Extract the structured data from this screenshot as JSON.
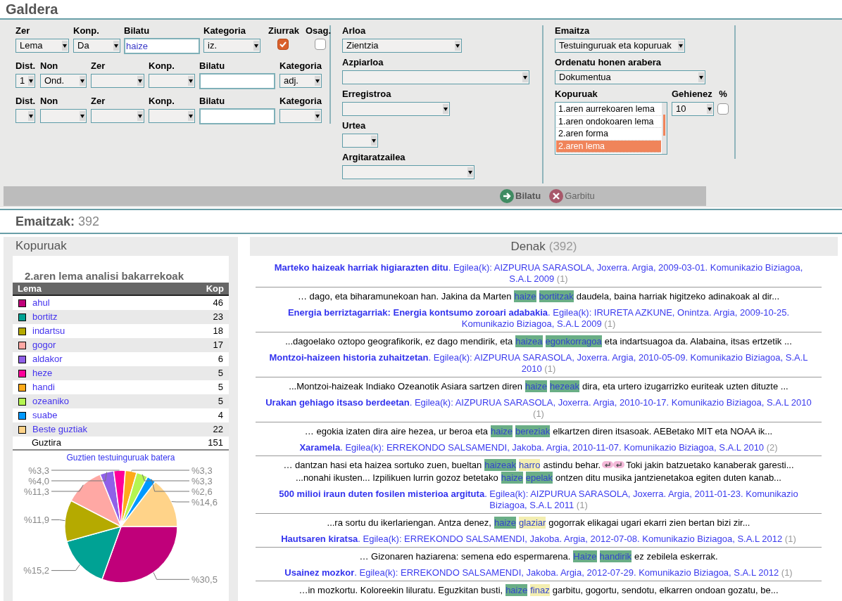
{
  "title": "Galdera",
  "query": {
    "rows": [
      {
        "fields": [
          {
            "label": "Zer",
            "kind": "select",
            "value": "Lema"
          },
          {
            "label": "Konp.",
            "kind": "select",
            "value": "Da"
          },
          {
            "label": "Bilatu",
            "kind": "text",
            "value": "haize"
          },
          {
            "label": "Kategoria",
            "kind": "select",
            "value": "iz."
          },
          {
            "label": "Ziurrak",
            "kind": "checkbox",
            "checked": true
          },
          {
            "label": "Osag.",
            "kind": "checkbox",
            "checked": false
          }
        ]
      },
      {
        "fields": [
          {
            "label": "Dist.",
            "kind": "select",
            "value": "1"
          },
          {
            "label": "Non",
            "kind": "select",
            "value": "Ond."
          },
          {
            "label": "Zer",
            "kind": "select"
          },
          {
            "label": "Konp.",
            "kind": "select"
          },
          {
            "label": "Bilatu",
            "kind": "text"
          },
          {
            "label": "Kategoria",
            "kind": "select",
            "value": "adj."
          }
        ]
      },
      {
        "fields": [
          {
            "label": "Dist.",
            "kind": "select"
          },
          {
            "label": "Non",
            "kind": "select"
          },
          {
            "label": "Zer",
            "kind": "select"
          },
          {
            "label": "Konp.",
            "kind": "select"
          },
          {
            "label": "Bilatu",
            "kind": "text"
          },
          {
            "label": "Kategoria",
            "kind": "select"
          }
        ]
      }
    ]
  },
  "filters": [
    {
      "label": "Arloa",
      "value": "Zientzia"
    },
    {
      "label": "Azpiarloa"
    },
    {
      "label": "Erregistroa"
    },
    {
      "label": "Urtea"
    },
    {
      "label": "Argitaratzailea"
    }
  ],
  "output": {
    "result_type": {
      "label": "Emaitza",
      "value": "Testuinguruak eta kopuruak"
    },
    "order": {
      "label": "Ordenatu honen arabera",
      "value": "Dokumentua"
    },
    "counts": {
      "label": "Kopuruak",
      "options": [
        {
          "text": "1.aren aurrekoaren lema",
          "selected": false
        },
        {
          "text": "1.aren ondokoaren lema",
          "selected": false
        },
        {
          "text": "2.aren forma",
          "selected": false
        },
        {
          "text": "2.aren lema",
          "selected": true
        }
      ]
    },
    "max": {
      "label": "Gehienez",
      "value": "10"
    },
    "percent": {
      "label": "%",
      "checked": false
    }
  },
  "actions": [
    {
      "label": "Bilatu",
      "kind": "search"
    },
    {
      "label": "Garbitu",
      "kind": "clear"
    }
  ],
  "results_heading": {
    "label": "Emaitzak:",
    "count": "392"
  },
  "counts_panel": {
    "title": "Kopuruak",
    "table_title": "2.aren lema analisi bakarrekoak",
    "columns": [
      "Lema",
      "Kop"
    ],
    "rows": [
      {
        "lemma": "ahul",
        "count": "46",
        "color": "#c0007a"
      },
      {
        "lemma": "bortitz",
        "count": "23",
        "color": "#00a294"
      },
      {
        "lemma": "indartsu",
        "count": "18",
        "color": "#b5aa00"
      },
      {
        "lemma": "gogor",
        "count": "17",
        "color": "#ffa8a4"
      },
      {
        "lemma": "aldakor",
        "count": "6",
        "color": "#9060e8"
      },
      {
        "lemma": "heze",
        "count": "5",
        "color": "#ff0099"
      },
      {
        "lemma": "handi",
        "count": "5",
        "color": "#ffaa1a"
      },
      {
        "lemma": "ozeaniko",
        "count": "5",
        "color": "#b5f551"
      },
      {
        "lemma": "suabe",
        "count": "4",
        "color": "#0099ff"
      },
      {
        "lemma": "Beste guztiak",
        "count": "22",
        "color": "#ffd389"
      }
    ],
    "total": {
      "label": "Guztira",
      "count": "151"
    },
    "chart_data": {
      "type": "pie",
      "title": "Guztien testuinguruak batera",
      "values": [
        30.5,
        15.2,
        11.9,
        11.3,
        4.0,
        3.3,
        3.3,
        3.3,
        2.6,
        14.6
      ],
      "value_labels": [
        "%30,5",
        "%15,2",
        "%11,9",
        "%11,3",
        "%4,0",
        "%3,3",
        "%3,3",
        "%3,3",
        "%2,6",
        "%14,6"
      ]
    }
  },
  "documents_panel": {
    "title": "Denak",
    "count": "(392)",
    "results": [
      {
        "title": "Marteko haizeak harriak higiarazten ditu",
        "source": ". Egilea(k): AIZPURUA SARASOLA, Joxerra. Argia, 2009-03-01. Komunikazio Biziagoa, S.A.L 2009",
        "count": "(1)",
        "contexts": [
          [
            {
              "kind": "text",
              "text": "… dago, eta biharamunekoan han. Jakina da Marten"
            },
            {
              "kind": "node",
              "text": "haize"
            },
            {
              "kind": "collocate",
              "sure": true,
              "text": "bortitzak"
            },
            {
              "kind": "text",
              "text": "daudela, baina harriak higitzeko adinakoak al dir..."
            }
          ]
        ]
      },
      {
        "title": "Energia berriztagarriak: Energia kontsumo zoroari adabakia",
        "source": ". Egilea(k): IRURETA AZKUNE, Onintza. Argia, 2009-10-25. Komunikazio Biziagoa, S.A.L 2009",
        "count": "(1)",
        "contexts": [
          [
            {
              "kind": "text",
              "text": "...dagoelako oztopo geografikorik, ez dago mendirik, eta"
            },
            {
              "kind": "node",
              "text": "haizea"
            },
            {
              "kind": "collocate",
              "sure": true,
              "text": "egonkorragoa"
            },
            {
              "kind": "text",
              "text": "eta indartsuagoa da. Alabaina, itsas ertzetik ..."
            }
          ]
        ]
      },
      {
        "title": "Montzoi-haizeen historia zuhaitzetan",
        "source": ". Egilea(k): AIZPURUA SARASOLA, Joxerra. Argia, 2010-05-09. Komunikazio Biziagoa, S.A.L 2010",
        "count": "(1)",
        "contexts": [
          [
            {
              "kind": "text",
              "text": "...Montzoi-haizeak Indiako Ozeanotik Asiara sartzen diren"
            },
            {
              "kind": "node",
              "text": "haize"
            },
            {
              "kind": "collocate",
              "sure": true,
              "text": "hezeak"
            },
            {
              "kind": "text",
              "text": "dira, eta urtero izugarrizko euriteak uzten dituzte ..."
            }
          ]
        ]
      },
      {
        "title": "Urakan gehiago itsaso berdeetan",
        "source": ". Egilea(k): AIZPURUA SARASOLA, Joxerra. Argia, 2010-10-17. Komunikazio Biziagoa, S.A.L 2010",
        "count": "(1)",
        "contexts": [
          [
            {
              "kind": "text",
              "text": "… egokia izaten dira aire hezea, ur beroa eta"
            },
            {
              "kind": "node",
              "text": "haize"
            },
            {
              "kind": "collocate",
              "sure": true,
              "text": "bereziak"
            },
            {
              "kind": "text",
              "text": "elkartzen diren itsasoak. AEBetako MIT eta NOAA ik..."
            }
          ]
        ]
      },
      {
        "title": "Xaramela",
        "source": ". Egilea(k): ERREKONDO SALSAMENDI, Jakoba. Argia, 2010-11-07. Komunikazio Biziagoa, S.A.L 2010",
        "count": "(2)",
        "contexts": [
          [
            {
              "kind": "text",
              "text": "… dantzan hasi eta haizea sortuko zuen, bueltan"
            },
            {
              "kind": "node",
              "text": "haizeak"
            },
            {
              "kind": "collocate",
              "sure": false,
              "text": "harro"
            },
            {
              "kind": "text",
              "text": "astindu behar."
            },
            {
              "kind": "break"
            },
            {
              "kind": "break"
            },
            {
              "kind": "text",
              "text": "Toki jakin batzuetako kanaberak garesti..."
            }
          ],
          [
            {
              "kind": "text",
              "text": "...nonahi ikusten... Izpilikuen lurrin gozoz betetako"
            },
            {
              "kind": "node",
              "text": "haize"
            },
            {
              "kind": "collocate",
              "sure": true,
              "text": "epelak"
            },
            {
              "kind": "text",
              "text": "ontzen ditu musika jantzienetakoa egiten duten kanab..."
            }
          ]
        ]
      },
      {
        "title": "500 milioi iraun duten fosilen misterioa argituta",
        "source": ". Egilea(k): AIZPURUA SARASOLA, Joxerra. Argia, 2011-01-23. Komunikazio Biziagoa, S.A.L 2011",
        "count": "(1)",
        "contexts": [
          [
            {
              "kind": "text",
              "text": "...ra sortu du ikerlariengan. Antza denez,"
            },
            {
              "kind": "node",
              "text": "haize"
            },
            {
              "kind": "collocate",
              "sure": false,
              "text": "glaziar"
            },
            {
              "kind": "text",
              "text": "gogorrak elikagai ugari ekarri zien bertan bizi zir..."
            }
          ]
        ]
      },
      {
        "title": "Hautsaren kiratsa",
        "source": ". Egilea(k): ERREKONDO SALSAMENDI, Jakoba. Argia, 2012-07-08. Komunikazio Biziagoa, S.A.L 2012",
        "count": "(1)",
        "contexts": [
          [
            {
              "kind": "text",
              "text": "… Gizonaren haziarena: semena edo espermarena."
            },
            {
              "kind": "node",
              "text": "Haize"
            },
            {
              "kind": "collocate",
              "sure": true,
              "text": "handirik"
            },
            {
              "kind": "text",
              "text": "ez zebilela eskerrak."
            }
          ]
        ]
      },
      {
        "title": "Usainez mozkor",
        "source": ". Egilea(k): ERREKONDO SALSAMENDI, Jakoba. Argia, 2012-07-29. Komunikazio Biziagoa, S.A.L 2012",
        "count": "(1)",
        "contexts": [
          [
            {
              "kind": "text",
              "text": "…in mozkortu. Koloreekin liluratu. Eguzkitan busti,"
            },
            {
              "kind": "node",
              "text": "haize"
            },
            {
              "kind": "collocate",
              "sure": false,
              "text": "finaz"
            },
            {
              "kind": "text",
              "text": "garbitu, gogortu, sendotu, elkarren ondoan gozatu, be..."
            }
          ]
        ]
      }
    ]
  }
}
